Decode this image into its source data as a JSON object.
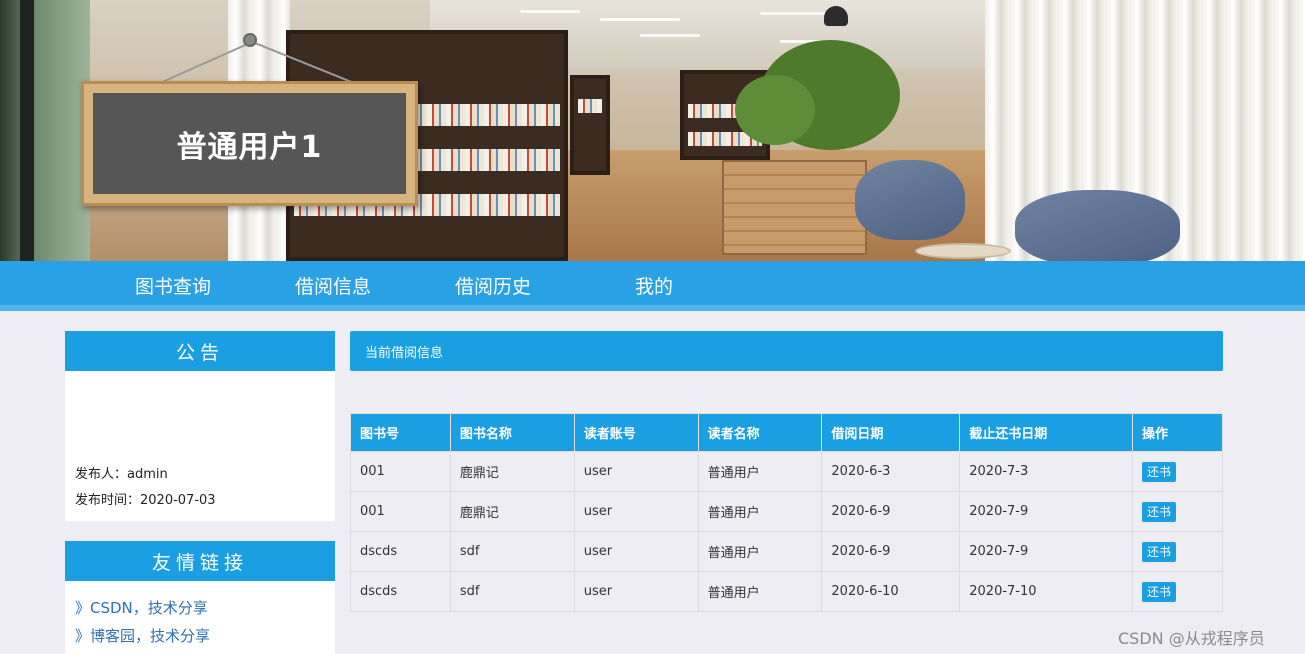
{
  "header": {
    "user_title": "普通用户1"
  },
  "nav": {
    "items": [
      {
        "label": "图书查询"
      },
      {
        "label": "借阅信息"
      },
      {
        "label": "借阅历史"
      },
      {
        "label": "我的"
      }
    ]
  },
  "notice": {
    "title": "公告",
    "publisher_label": "发布人：admin",
    "publish_time_label": "发布时间：2020-07-03"
  },
  "links": {
    "title": "友情链接",
    "items": [
      {
        "label": "》CSDN，技术分享"
      },
      {
        "label": "》博客园，技术分享"
      }
    ]
  },
  "main": {
    "title": "当前借阅信息",
    "columns": [
      "图书号",
      "图书名称",
      "读者账号",
      "读者名称",
      "借阅日期",
      "截止还书日期",
      "操作"
    ],
    "rows": [
      {
        "book_id": "001",
        "book_name": "鹿鼎记",
        "reader_account": "user",
        "reader_name": "普通用户",
        "borrow_date": "2020-6-3",
        "due_date": "2020-7-3",
        "action": "还书"
      },
      {
        "book_id": "001",
        "book_name": "鹿鼎记",
        "reader_account": "user",
        "reader_name": "普通用户",
        "borrow_date": "2020-6-9",
        "due_date": "2020-7-9",
        "action": "还书"
      },
      {
        "book_id": "dscds",
        "book_name": "sdf",
        "reader_account": "user",
        "reader_name": "普通用户",
        "borrow_date": "2020-6-9",
        "due_date": "2020-7-9",
        "action": "还书"
      },
      {
        "book_id": "dscds",
        "book_name": "sdf",
        "reader_account": "user",
        "reader_name": "普通用户",
        "borrow_date": "2020-6-10",
        "due_date": "2020-7-10",
        "action": "还书"
      }
    ]
  },
  "watermark": "CSDN @从戎程序员",
  "colors": {
    "accent": "#1a9fe3",
    "background": "#eeedf3",
    "link": "#2f6fb3"
  }
}
